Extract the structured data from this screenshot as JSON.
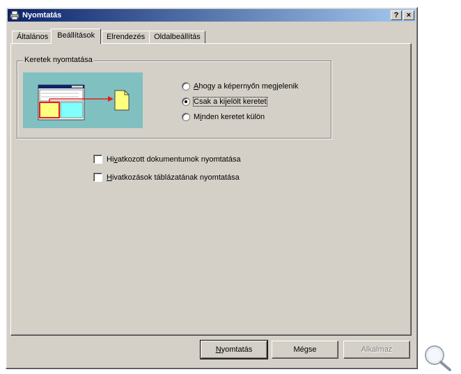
{
  "window": {
    "title": "Nyomtatás",
    "help_label": "?",
    "close_label": "×"
  },
  "tabs": [
    {
      "label": "Általános",
      "active": false
    },
    {
      "label": "Beállítások",
      "active": true
    },
    {
      "label": "Elrendezés",
      "active": false
    },
    {
      "label": "Oldalbeállítás",
      "active": false
    }
  ],
  "frames_group": {
    "legend": "Keretek nyomtatása",
    "options": [
      {
        "hotkey": "A",
        "rest": "hogy a képernyőn megjelenik",
        "checked": false
      },
      {
        "hotkey": "",
        "rest": "Csak a kijelölt keretet",
        "checked": true
      },
      {
        "pre": "M",
        "hotkey": "i",
        "rest": "nden keretet külön",
        "checked": false
      }
    ]
  },
  "checkboxes": [
    {
      "pre": "Hi",
      "hotkey": "v",
      "rest": "atkozott dokumentumok nyomtatása",
      "checked": false
    },
    {
      "pre": "",
      "hotkey": "H",
      "rest": "ivatkozások táblázatának nyomtatása",
      "checked": false
    }
  ],
  "buttons": {
    "print": {
      "hotkey": "N",
      "rest": "yomtatás"
    },
    "cancel": "Mégse",
    "apply": "Alkalmaz"
  },
  "colors": {
    "titlebar_start": "#0a246a",
    "titlebar_end": "#a6caf0",
    "face": "#d4d0c8",
    "preview_bg": "#80c0c0"
  }
}
